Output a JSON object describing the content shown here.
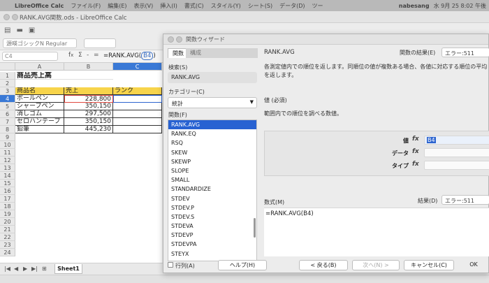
{
  "menubar": {
    "app_name": "LibreOffice Calc",
    "items": [
      "ファイル(F)",
      "編集(E)",
      "表示(V)",
      "挿入(I)",
      "書式(C)",
      "スタイル(Y)",
      "シート(S)",
      "データ(D)",
      "ツー"
    ],
    "user": "nabesang",
    "clock": "水 9月 25 8:02 午後"
  },
  "window": {
    "title": "RANK.AVG関数.ods - LibreOffice Calc"
  },
  "toolbar": {
    "font_name": "源暎ゴシックN Regular"
  },
  "formula_bar": {
    "cell_ref": "C4",
    "formula_prefix": "=RANK.AVG(",
    "formula_ref": "B4",
    "formula_suffix": ")"
  },
  "sheet": {
    "columns": [
      "A",
      "B",
      "C"
    ],
    "selected_column": "C",
    "rows": [
      "1",
      "2",
      "3",
      "4",
      "5",
      "6",
      "7",
      "8",
      "9",
      "10",
      "11",
      "12",
      "13",
      "14",
      "15",
      "16",
      "17",
      "18",
      "19",
      "20",
      "21",
      "22",
      "23",
      "24"
    ],
    "selected_row": "4",
    "title": "商品売上高",
    "headers": [
      "商品名",
      "売上",
      "ランク"
    ],
    "data": [
      [
        "ボールペン",
        "228,800"
      ],
      [
        "シャープペン",
        "350,150"
      ],
      [
        "消しゴム",
        "297,500"
      ],
      [
        "セロハンテープ",
        "350,150"
      ],
      [
        "鉛筆",
        "445,230"
      ]
    ],
    "tab_name": "Sheet1"
  },
  "dialog": {
    "title": "関数ウィザード",
    "tabs": [
      "関数",
      "構成"
    ],
    "search_label": "検索(S)",
    "search_value": "RANK.AVG",
    "category_label": "カテゴリー(C)",
    "category_value": "統計",
    "function_label": "関数(F)",
    "functions": [
      "RANK.AVG",
      "RANK.EQ",
      "RSQ",
      "SKEW",
      "SKEWP",
      "SLOPE",
      "SMALL",
      "STANDARDIZE",
      "STDEV",
      "STDEV.P",
      "STDEV.S",
      "STDEVA",
      "STDEVP",
      "STDEVPA",
      "STEYX"
    ],
    "selected_function": "RANK.AVG",
    "func_name": "RANK.AVG",
    "func_result_label": "関数の結果(E)",
    "func_result_value": "エラー:511",
    "description": "各測定値内での順位を返します。同順位の値が複数ある場合、各値に対応する順位の平均を返します。",
    "param_title": "値 (必須)",
    "param_desc": "範囲内での順位を調べる数値。",
    "args": [
      {
        "label": "値",
        "value": "B4"
      },
      {
        "label": "データ",
        "value": ""
      },
      {
        "label": "タイプ",
        "value": ""
      }
    ],
    "formula_label": "数式(M)",
    "result_label": "結果(D)",
    "result_value": "エラー:511",
    "formula_value": "=RANK.AVG(B4)",
    "array_label": "行列(A)",
    "buttons": {
      "help": "ヘルプ(H)",
      "back": "< 戻る(B)",
      "next": "次へ(N) >",
      "cancel": "キャンセル(C)",
      "ok": "OK"
    }
  },
  "colors": {
    "selection": "#2862d2",
    "header_fill": "#f7d44b",
    "active_cell_border": "#e0483e"
  }
}
